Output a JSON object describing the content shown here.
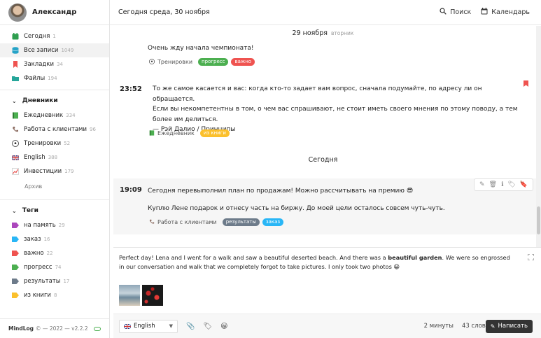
{
  "user": {
    "name": "Александр"
  },
  "nav": [
    {
      "label": "Сегодня",
      "count": "1",
      "icon": "calendar-icon",
      "color": "#2e9e4f"
    },
    {
      "label": "Все записи",
      "count": "1049",
      "icon": "database-icon",
      "color": "#26a3c7"
    },
    {
      "label": "Закладки",
      "count": "34",
      "icon": "bookmark-icon",
      "color": "#ef5350"
    },
    {
      "label": "Файлы",
      "count": "194",
      "icon": "folder-icon",
      "color": "#26a69a"
    }
  ],
  "diaries": {
    "title": "Дневники",
    "items": [
      {
        "label": "Ежедневник",
        "count": "334",
        "icon": "green-book-icon"
      },
      {
        "label": "Работа с клиентами",
        "count": "96",
        "icon": "phone-icon"
      },
      {
        "label": "Тренировки",
        "count": "52",
        "icon": "soccer-ball-icon"
      },
      {
        "label": "English",
        "count": "388",
        "icon": "uk-flag-icon"
      },
      {
        "label": "Инвестиции",
        "count": "179",
        "icon": "chart-increasing-icon"
      }
    ],
    "archive": "Архив"
  },
  "tags": {
    "title": "Теги",
    "items": [
      {
        "label": "на память",
        "count": "29",
        "color": "#ab47bc"
      },
      {
        "label": "заказ",
        "count": "16",
        "color": "#29b6f6"
      },
      {
        "label": "важно",
        "count": "22",
        "color": "#ef5350"
      },
      {
        "label": "прогресс",
        "count": "74",
        "color": "#4caf50"
      },
      {
        "label": "результаты",
        "count": "17",
        "color": "#6d7b8a"
      },
      {
        "label": "из книги",
        "count": "8",
        "color": "#fbc02d"
      }
    ]
  },
  "footer": {
    "brand": "MindLog",
    "text": "© — 2022 — v2.2.2"
  },
  "topbar": {
    "date": "Сегодня среда, 30 ноября",
    "search": "Поиск",
    "calendar": "Календарь"
  },
  "feed": {
    "day1": {
      "date": "29 ноября",
      "weekday": "вторник"
    },
    "entry1": {
      "text": "Очень жду начала чемпионата!",
      "category": "Тренировки",
      "tags": [
        {
          "label": "прогресс",
          "color": "#4caf50"
        },
        {
          "label": "важно",
          "color": "#ef5350"
        }
      ]
    },
    "entry2": {
      "time": "23:52",
      "lines": [
        "То же самое касается и вас: когда кто-то задает вам вопрос, сначала подумайте, по адресу ли он обращается.",
        "Если вы некомпетентны в том, о чем вас спрашивают, не стоит иметь своего мнения по этому поводу, а тем",
        "более им делиться.",
        "— Рэй Далио / Принципы"
      ],
      "category": "Ежедневник",
      "tags": [
        {
          "label": "из книги",
          "color": "#fbc02d"
        }
      ]
    },
    "day2": {
      "date": "Сегодня"
    },
    "entry3": {
      "time": "19:09",
      "line1": "Сегодня перевыполнил план по продажам! Можно рассчитывать на премию 😎",
      "line2": "Куплю Лене подарок и отнесу часть на биржу. До моей цели осталось совсем чуть-чуть.",
      "category": "Работа с клиентами",
      "tags": [
        {
          "label": "результаты",
          "color": "#6d7b8a"
        },
        {
          "label": "заказ",
          "color": "#29b6f6"
        }
      ]
    }
  },
  "composer": {
    "text_before": "Perfect day! Lena and I went for a walk and saw a beautiful deserted beach. And there was a ",
    "text_bold": "beautiful garden",
    "text_after": ". We were so engrossed in our conversation and walk that we completely forgot to take pictures. I only took two photos 😀",
    "language": "English",
    "duration": "2 минуты",
    "words": "43 слова",
    "submit": "Написать"
  }
}
